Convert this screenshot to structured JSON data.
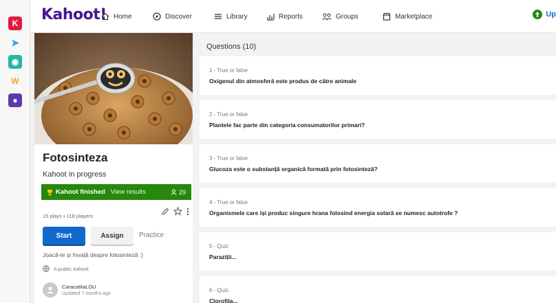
{
  "apps": [
    {
      "name": "kahoot-app-icon",
      "glyph": "K",
      "color": "#e21b3c"
    },
    {
      "name": "arrow-app-icon",
      "glyph": "➤",
      "color": "#2aa4f4"
    },
    {
      "name": "chat-app-icon",
      "glyph": "◉",
      "color": "#26b6a3"
    },
    {
      "name": "w-app-icon",
      "glyph": "W",
      "color": "#f4a72a"
    },
    {
      "name": "monster-app-icon",
      "glyph": "●",
      "color": "#5b3bb0"
    }
  ],
  "nav": {
    "logo": "Kahoot!",
    "home": "Home",
    "discover": "Discover",
    "library": "Library",
    "reports": "Reports",
    "groups": "Groups",
    "marketplace": "Marketplace",
    "upgrade": "Up"
  },
  "kahoot": {
    "title": "Fotosinteza",
    "subtitle": "Kahoot in progress",
    "finished_label": "Kahoot finished",
    "view_results": "View results",
    "player_count": "29",
    "stats": "15 plays • 118 players",
    "start": "Start",
    "assign": "Assign",
    "practice": "Practice",
    "description": "Joacă-te și învață despre fotosinteză :)",
    "visibility": "A public kahoot",
    "author_name": "CaracatitaLOU",
    "author_updated": "Updated 7 months ago"
  },
  "questions_header": "Questions (10)",
  "questions": [
    {
      "type": "1 - True or false",
      "text": "Oxigenul din atmosferă este produs de către animale"
    },
    {
      "type": "2 - True or false",
      "text": "Plantele fac parte din categoria consumatorilor primari?"
    },
    {
      "type": "3 - True or false",
      "text": "Glucoza este o substanță organică formată prin fotosinteză?"
    },
    {
      "type": "4 - True or false",
      "text": "Organismele care își produc singure hrana folosind energia solară se numesc autotrofe ?"
    },
    {
      "type": "5 - Quiz",
      "text": "Paraziții..."
    },
    {
      "type": "6 - Quiz",
      "text": "Clorofila..."
    }
  ],
  "colors": {
    "brand": "#46178f",
    "start": "#1368ce",
    "finished": "#26890c"
  }
}
